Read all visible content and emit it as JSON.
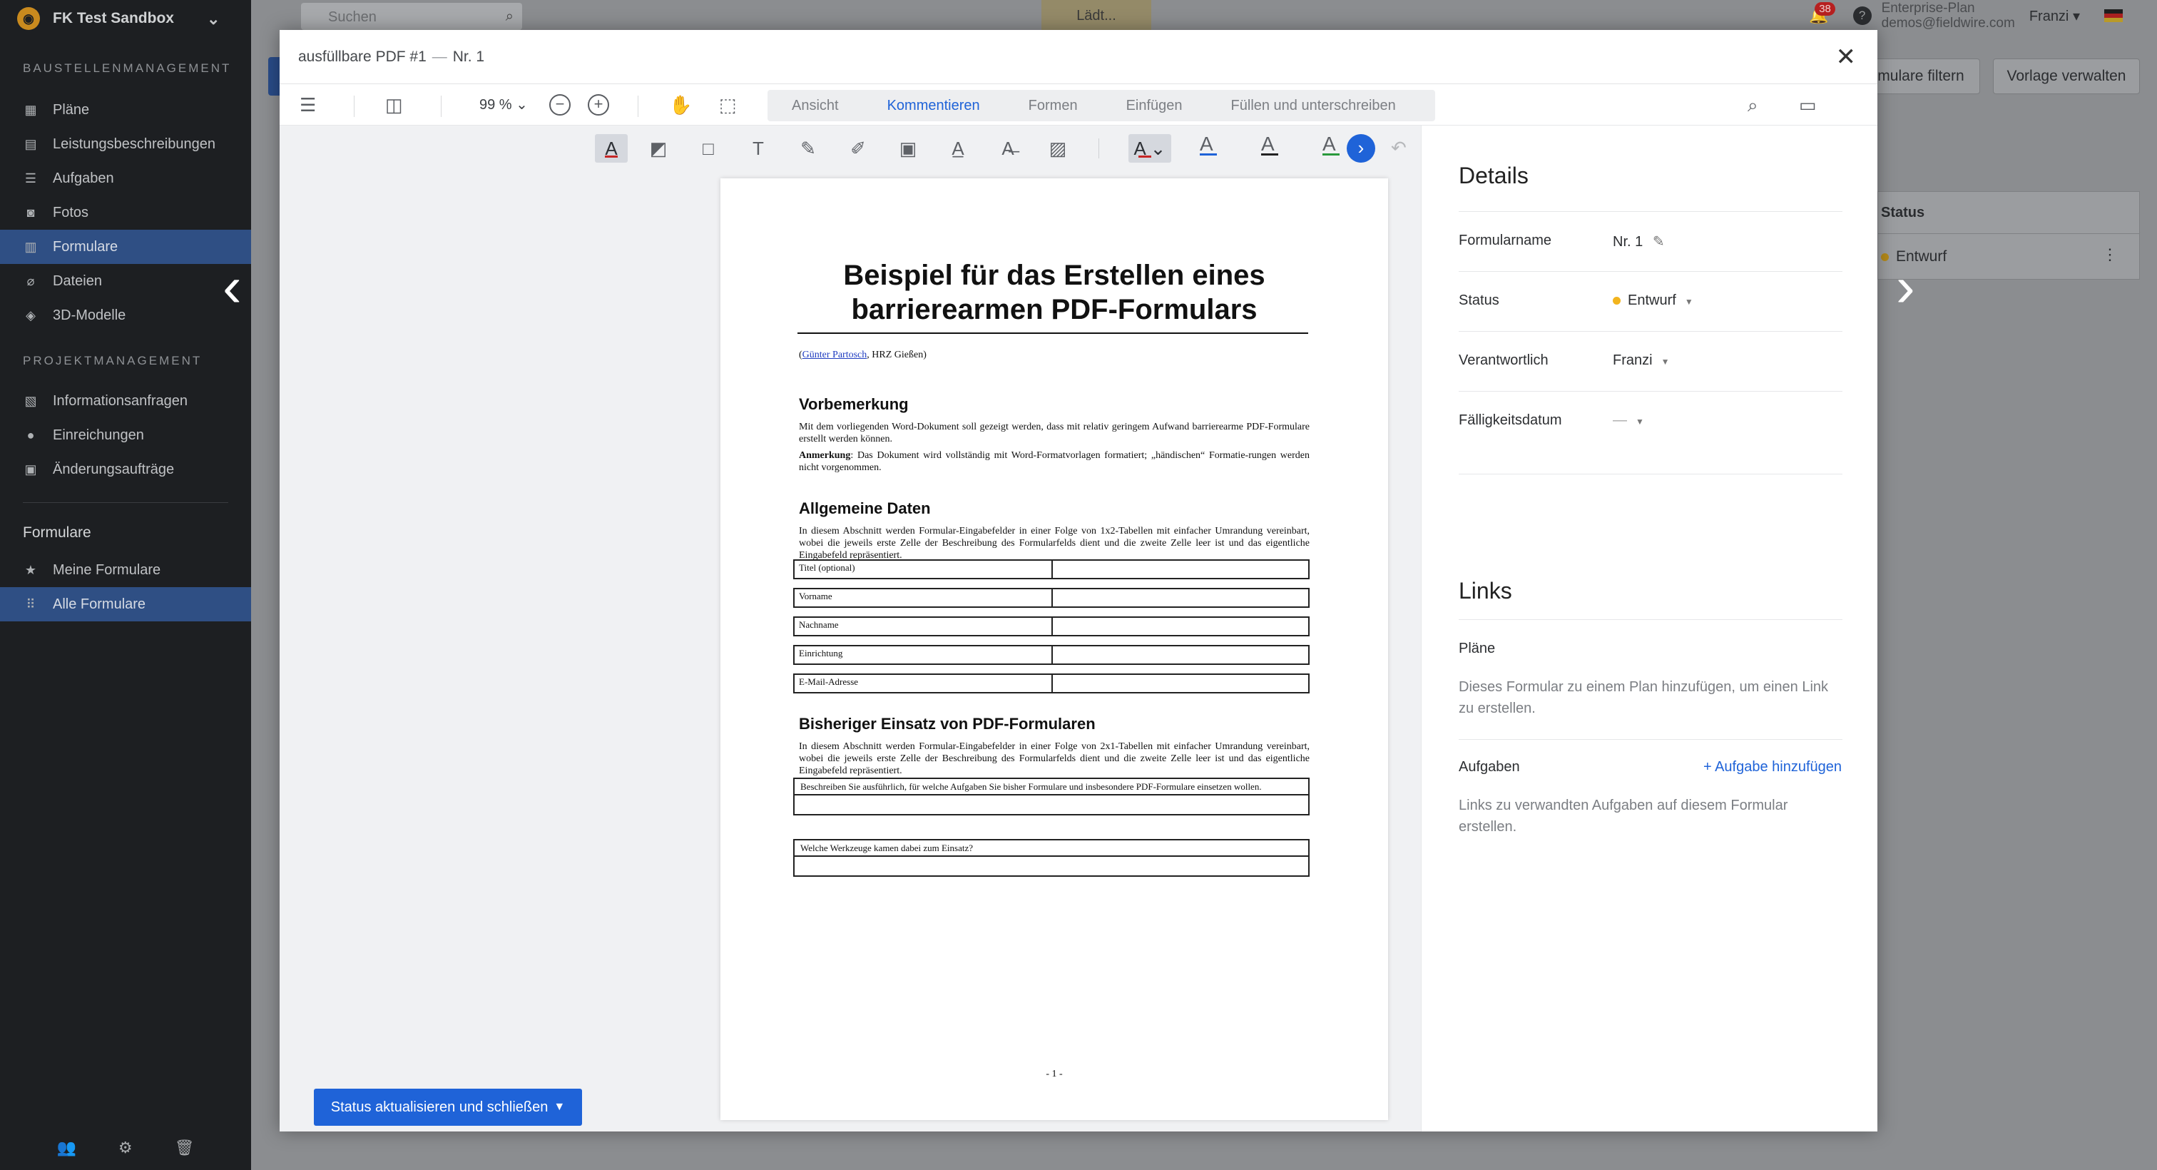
{
  "sidebar": {
    "project_name": "FK Test Sandbox",
    "section_site": "BAUSTELLENMANAGEMENT",
    "site_items": [
      {
        "label": "Pläne"
      },
      {
        "label": "Leistungsbeschreibungen"
      },
      {
        "label": "Aufgaben"
      },
      {
        "label": "Fotos"
      },
      {
        "label": "Formulare"
      },
      {
        "label": "Dateien"
      },
      {
        "label": "3D-Modelle"
      }
    ],
    "section_project": "PROJEKTMANAGEMENT",
    "project_items": [
      {
        "label": "Informationsanfragen"
      },
      {
        "label": "Einreichungen"
      },
      {
        "label": "Änderungsaufträge"
      }
    ],
    "forms_heading": "Formulare",
    "forms_items": [
      {
        "label": "Meine Formulare"
      },
      {
        "label": "Alle Formulare"
      }
    ]
  },
  "topbar": {
    "search_placeholder": "Suchen",
    "loading_text": "Lädt...",
    "notification_count": "38",
    "help_label": "?",
    "plan_name": "Enterprise-Plan",
    "plan_email": "demos@fieldwire.com",
    "user_name": "Franzi"
  },
  "background": {
    "filter_button": "mulare filtern",
    "template_button": "Vorlage verwalten",
    "table_header_status": "Status",
    "row_status": "Entwurf"
  },
  "modal": {
    "title_file": "ausfüllbare PDF #1",
    "title_separator": "—",
    "title_form": "Nr. 1",
    "zoom_level": "99 %",
    "tabs": [
      {
        "label": "Ansicht",
        "active": false
      },
      {
        "label": "Kommentieren",
        "active": true
      },
      {
        "label": "Formen",
        "active": false
      },
      {
        "label": "Einfügen",
        "active": false
      },
      {
        "label": "Füllen und unterschreiben",
        "active": false
      }
    ],
    "status_button": "Status aktualisieren und schließen"
  },
  "pdf": {
    "title_line1": "Beispiel für das Erstellen eines",
    "title_line2": "barrierearmen PDF-Formulars",
    "author_link": "Günter Partosch",
    "author_rest": ", HRZ Gießen)",
    "author_open": "(",
    "h_vorbemerkung": "Vorbemerkung",
    "p_vorbemerkung": "Mit dem vorliegenden Word-Dokument soll gezeigt werden, dass mit relativ geringem Aufwand barrierearme PDF-Formulare erstellt werden können.",
    "anmerkung_label": "Anmerkung",
    "anmerkung_text": ": Das Dokument wird vollständig mit Word-Formatvorlagen formatiert; „händischen“ Formatie-rungen werden nicht vorgenommen.",
    "h_allgemein": "Allgemeine Daten",
    "p_allgemein": "In diesem Abschnitt werden Formular-Eingabefelder in einer Folge von 1x2-Tabellen mit einfacher Umrandung vereinbart, wobei die jeweils erste Zelle der Beschreibung des Formularfelds dient und die zweite Zelle leer ist und das eigentliche Eingabefeld repräsentiert.",
    "fields": [
      "Titel (optional)",
      "Vorname",
      "Nachname",
      "Einrichtung",
      "E-Mail-Adresse"
    ],
    "h_bisheriger": "Bisheriger Einsatz von PDF-Formularen",
    "p_bisheriger": "In diesem Abschnitt werden Formular-Eingabefelder in einer Folge von 2x1-Tabellen mit einfacher Umrandung vereinbart, wobei die jeweils erste Zelle der Beschreibung des Formularfelds dient und die zweite Zelle leer ist und das eigentliche Eingabefeld repräsentiert.",
    "q1": "Beschreiben Sie ausführlich, für welche Aufgaben Sie bisher Formulare und insbesondere PDF-Formulare einsetzen wollen.",
    "q2": "Welche Werkzeuge kamen dabei zum Einsatz?",
    "page_number": "- 1 -"
  },
  "details": {
    "heading": "Details",
    "form_name_label": "Formularname",
    "form_name_value": "Nr. 1",
    "status_label": "Status",
    "status_value": "Entwurf",
    "responsible_label": "Verantwortlich",
    "responsible_value": "Franzi",
    "due_label": "Fälligkeitsdatum",
    "due_value": "—",
    "links_heading": "Links",
    "plans_label": "Pläne",
    "plans_hint": "Dieses Formular zu einem Plan hinzufügen, um einen Link zu erstellen.",
    "tasks_label": "Aufgaben",
    "add_task_link": "+ Aufgabe hinzufügen",
    "tasks_hint": "Links zu verwandten Aufgaben auf diesem Formular erstellen."
  },
  "colors": {
    "accent": "#1f63d8",
    "sidebar_bg": "#1d1f22",
    "status_draft": "#f2b41e",
    "notification": "#b72020"
  }
}
